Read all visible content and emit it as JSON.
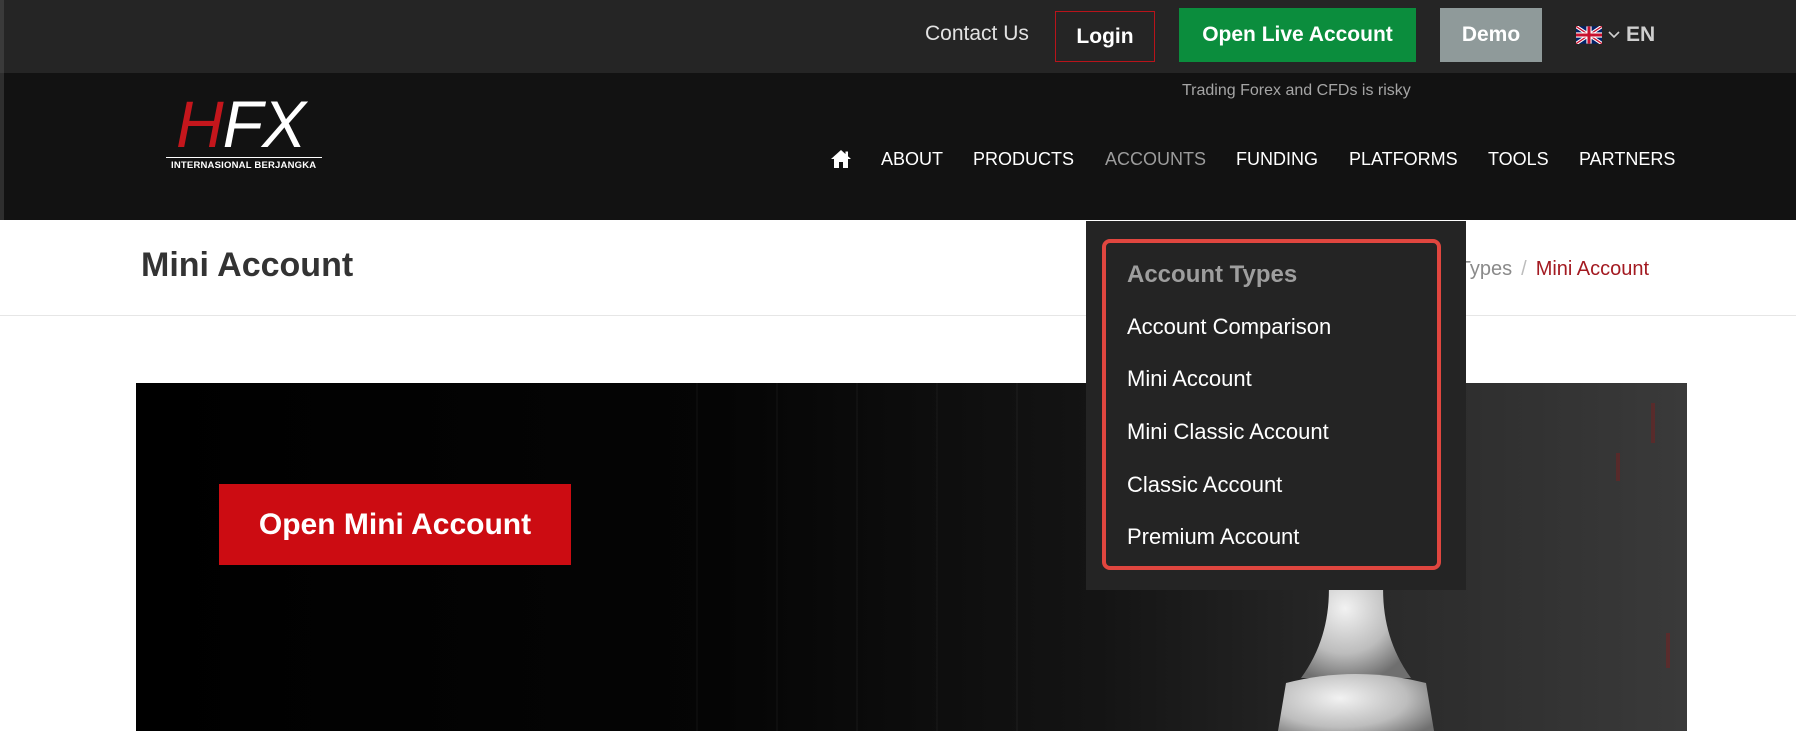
{
  "topbar": {
    "contact_label": "Contact Us",
    "login_label": "Login",
    "live_label": "Open Live Account",
    "demo_label": "Demo",
    "lang_label": "EN"
  },
  "header": {
    "risk_notice": "Trading Forex and CFDs is risky",
    "logo": {
      "letter_h": "H",
      "letters_fx": "FX",
      "tagline": "INTERNASIONAL BERJANGKA"
    },
    "nav": [
      {
        "label": "ABOUT"
      },
      {
        "label": "PRODUCTS"
      },
      {
        "label": "ACCOUNTS"
      },
      {
        "label": "FUNDING"
      },
      {
        "label": "PLATFORMS"
      },
      {
        "label": "TOOLS"
      },
      {
        "label": "PARTNERS"
      }
    ]
  },
  "page": {
    "title": "Mini Account",
    "breadcrumb": {
      "partial": "t Types",
      "separator": "/",
      "current": "Mini Account"
    }
  },
  "hero": {
    "cta_label": "Open Mini Account"
  },
  "dropdown": {
    "heading": "Account Types",
    "items": [
      {
        "label": "Account Comparison"
      },
      {
        "label": "Mini Account"
      },
      {
        "label": "Mini Classic Account"
      },
      {
        "label": "Classic Account"
      },
      {
        "label": "Premium Account"
      }
    ]
  },
  "colors": {
    "accent_red": "#cc0c12",
    "live_green": "#0b8d3d",
    "demo_grey": "#8f9a9a",
    "highlight_frame": "#e0463f"
  }
}
